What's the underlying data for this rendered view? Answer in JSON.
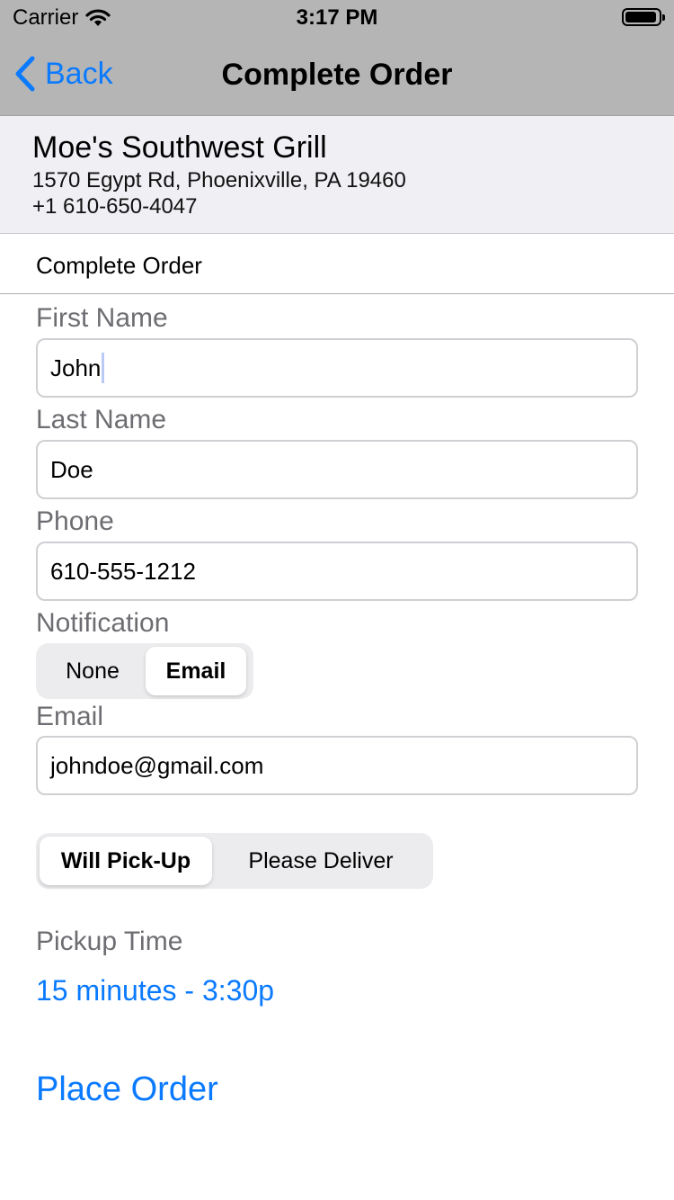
{
  "status_bar": {
    "carrier": "Carrier",
    "time": "3:17 PM",
    "battery_level": 0.95
  },
  "nav": {
    "back_label": "Back",
    "title": "Complete Order"
  },
  "restaurant": {
    "name": "Moe's Southwest Grill",
    "address": "1570 Egypt Rd, Phoenixville, PA 19460",
    "phone": "+1 610-650-4047"
  },
  "section_title": "Complete Order",
  "form": {
    "first_name": {
      "label": "First Name",
      "value": "John"
    },
    "last_name": {
      "label": "Last Name",
      "value": "Doe"
    },
    "phone": {
      "label": "Phone",
      "value": "610-555-1212"
    },
    "notification": {
      "label": "Notification",
      "options": [
        "None",
        "Email"
      ],
      "selected": "Email"
    },
    "email": {
      "label": "Email",
      "value": "johndoe@gmail.com"
    },
    "fulfillment": {
      "options": [
        "Will Pick-Up",
        "Please Deliver"
      ],
      "selected": "Will Pick-Up"
    },
    "pickup_time": {
      "label": "Pickup Time",
      "value": "15 minutes - 3:30p"
    }
  },
  "place_order_label": "Place Order",
  "colors": {
    "accent": "#0a7aff",
    "nav_bg": "#b5b5b5",
    "header_bg": "#efeff4",
    "label": "#6d6d72"
  }
}
